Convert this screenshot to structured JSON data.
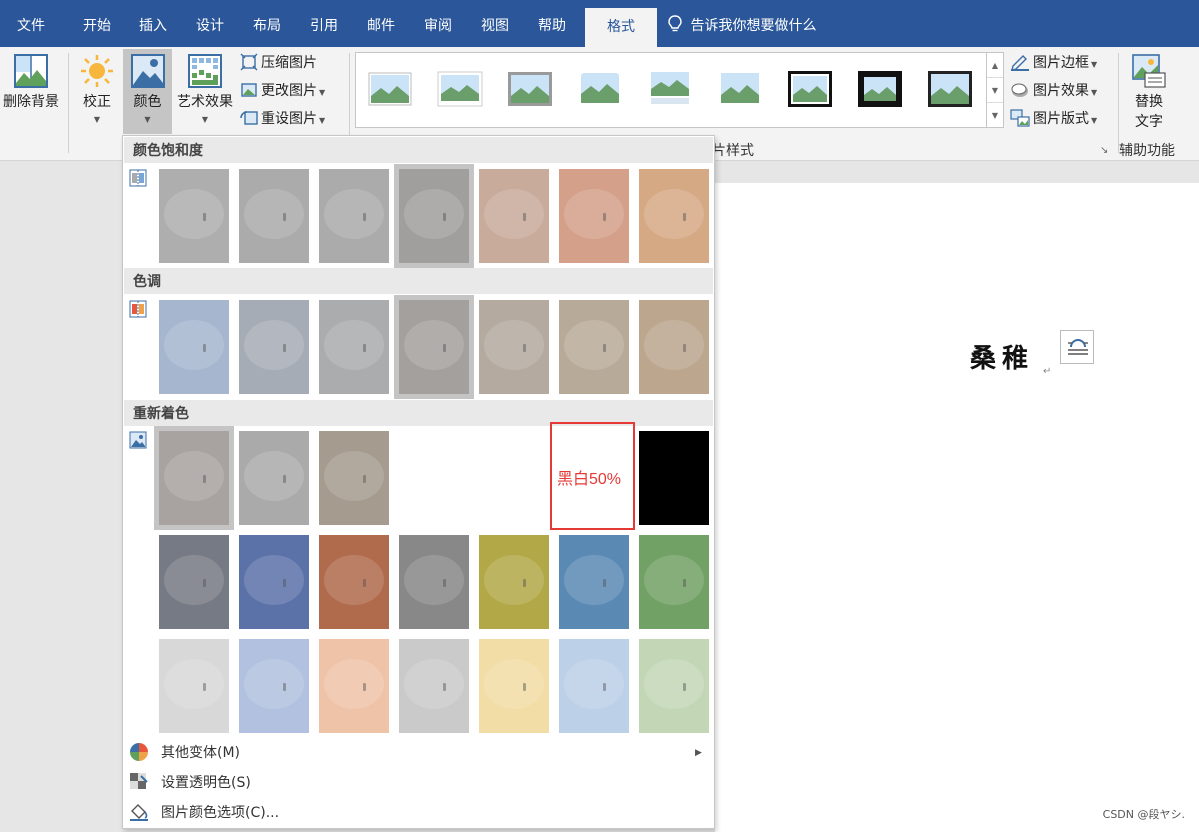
{
  "tabs": [
    {
      "label": "文件",
      "active": false
    },
    {
      "label": "开始",
      "active": false
    },
    {
      "label": "插入",
      "active": false
    },
    {
      "label": "设计",
      "active": false
    },
    {
      "label": "布局",
      "active": false
    },
    {
      "label": "引用",
      "active": false
    },
    {
      "label": "邮件",
      "active": false
    },
    {
      "label": "审阅",
      "active": false
    },
    {
      "label": "视图",
      "active": false
    },
    {
      "label": "帮助",
      "active": false
    },
    {
      "label": "格式",
      "active": true
    }
  ],
  "tell_me": "告诉我你想要做什么",
  "ribbon": {
    "remove_bg": "删除背景",
    "corrections": "校正",
    "color": "颜色",
    "artistic": "艺术效果",
    "compress": "压缩图片",
    "change": "更改图片",
    "reset": "重设图片",
    "styles_group": "片样式",
    "border": "图片边框",
    "effects": "图片效果",
    "layout": "图片版式",
    "alt_text_line1": "替换",
    "alt_text_line2": "文字",
    "accessibility": "辅助功能"
  },
  "dropdown": {
    "sections": [
      {
        "title": "颜色饱和度",
        "swatches": [
          "#aeaeae",
          "#ababab",
          "#ababab",
          "#a09f9d",
          "#c8ab9b",
          "#d4a08a",
          "#d6a985"
        ],
        "selected": 3
      },
      {
        "title": "色调",
        "swatches": [
          "#a6b6ce",
          "#a6acb6",
          "#abacae",
          "#a3a09d",
          "#b4aaa0",
          "#b8aa98",
          "#bca68e"
        ],
        "selected": 3
      },
      {
        "title": "重新着色",
        "swatches": [
          "#a8a2a0",
          "#aaaaaa",
          "#a69b8f",
          "#ffffff",
          "#ffffff",
          "#ffffff",
          "#000000",
          "#767a84",
          "#5b72a8",
          "#b06b4d",
          "#888888",
          "#b3a847",
          "#5a8ab4",
          "#71a165",
          "#d8d8d8",
          "#b1c1df",
          "#efc3a8",
          "#cacaca",
          "#f2dda6",
          "#bcd0e8",
          "#c3d7b6"
        ],
        "selected": 0
      }
    ],
    "highlight_label": "黑白50%",
    "menu": {
      "more_variations": "其他变体(M)",
      "set_transparent": "设置透明色(S)",
      "color_options": "图片颜色选项(C)..."
    }
  },
  "doc": {
    "text": "桑稚"
  },
  "watermark": "CSDN @段ヤシ."
}
